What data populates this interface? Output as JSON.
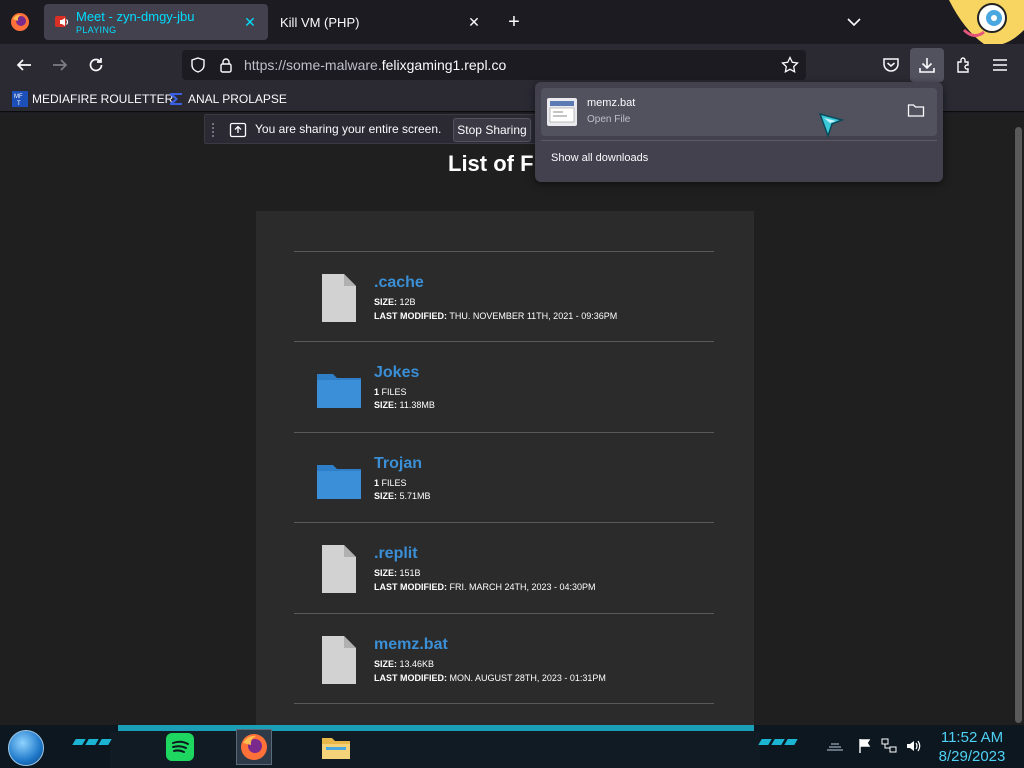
{
  "browser": {
    "tabs": [
      {
        "title": "Meet - zyn-dmgy-jbu",
        "status": "PLAYING",
        "active": true
      },
      {
        "title": "Kill VM (PHP)",
        "active": false
      }
    ],
    "url_prefix": "https://some-malware.",
    "url_domain": "felixgaming1.repl.co",
    "bookmarks": [
      {
        "label": "MEDIAFIRE ROULETTER"
      },
      {
        "label": "ANAL PROLAPSE"
      }
    ]
  },
  "sharing_bar": {
    "message": "You are sharing your entire screen.",
    "stop_label": "Stop Sharing"
  },
  "downloads": {
    "item_name": "memz.bat",
    "item_status": "Open File",
    "show_all": "Show all downloads"
  },
  "page": {
    "title": "List of Fil",
    "files": [
      {
        "name": ".cache",
        "type": "file",
        "line1_key": "SIZE:",
        "line1_val": " 12B",
        "line2_key": "LAST MODIFIED:",
        "line2_val": " THU. NOVEMBER 11TH, 2021 - 09:36PM"
      },
      {
        "name": "Jokes",
        "type": "folder",
        "line1_key": "1",
        "line1_val": " FILES",
        "line2_key": "SIZE:",
        "line2_val": " 11.38MB"
      },
      {
        "name": "Trojan",
        "type": "folder",
        "line1_key": "1",
        "line1_val": " FILES",
        "line2_key": "SIZE:",
        "line2_val": " 5.71MB"
      },
      {
        "name": ".replit",
        "type": "file",
        "line1_key": "SIZE:",
        "line1_val": " 151B",
        "line2_key": "LAST MODIFIED:",
        "line2_val": " FRI. MARCH 24TH, 2023 - 04:30PM"
      },
      {
        "name": "memz.bat",
        "type": "file",
        "line1_key": "SIZE:",
        "line1_val": " 13.46KB",
        "line2_key": "LAST MODIFIED:",
        "line2_val": " MON. AUGUST 28TH, 2023 - 01:31PM"
      }
    ]
  },
  "taskbar": {
    "time": "11:52 AM",
    "date": "8/29/2023",
    "apps": [
      "spotify-icon",
      "firefox-icon",
      "file-explorer-icon"
    ]
  },
  "colors": {
    "link_blue": "#3a8fd6",
    "folder_blue": "#3b8fd8",
    "playing_cyan": "#00ddff",
    "clock_cyan": "#4fd1f5"
  }
}
